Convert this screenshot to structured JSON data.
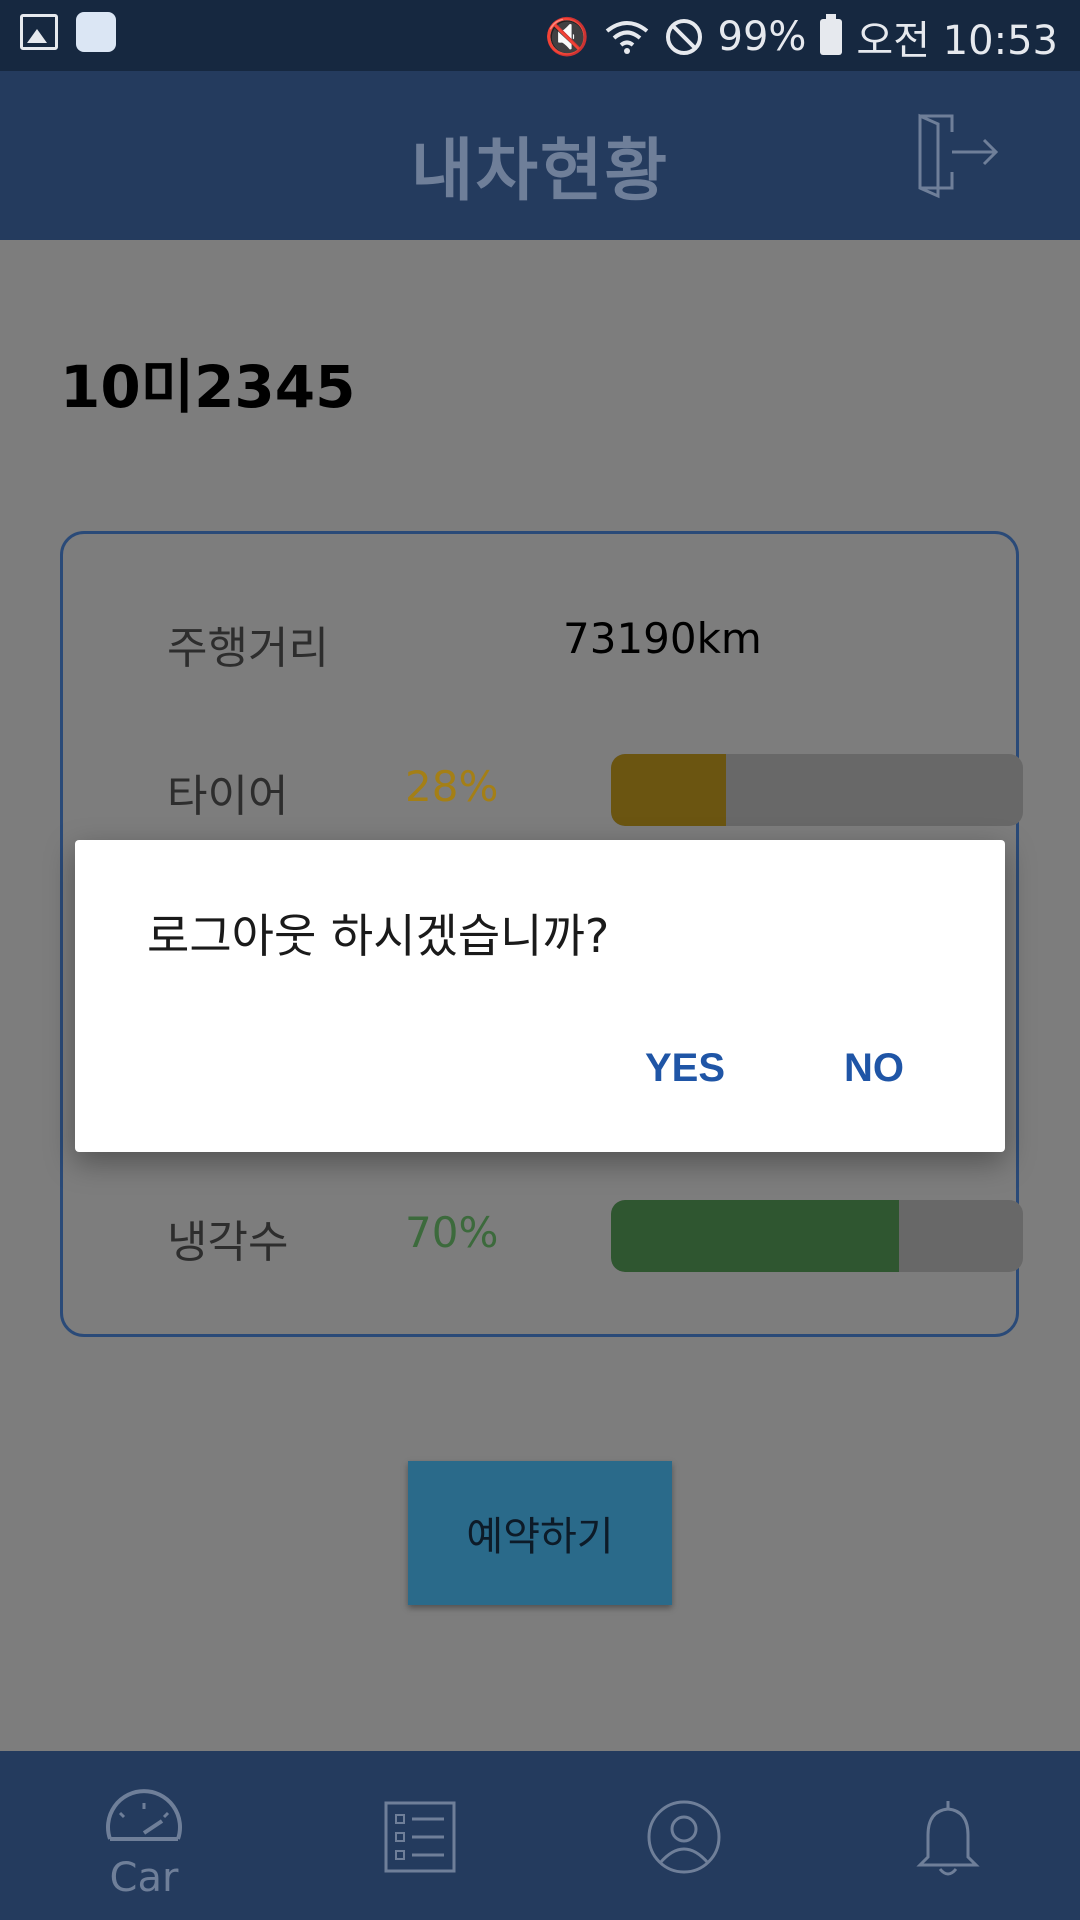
{
  "status_bar": {
    "battery_percent": "99%",
    "time": "오전 10:53"
  },
  "header": {
    "title": "내차현황",
    "logout_icon": "logout-icon"
  },
  "car": {
    "plate": "10미2345",
    "mileage_label": "주행거리",
    "mileage_value": "73190km",
    "tire_label": "타이어",
    "tire_percent": "28%",
    "tire_level": 0.28,
    "tire_color": "#6b5511",
    "coolant_label": "냉각수",
    "coolant_percent": "70%",
    "coolant_level": 0.7,
    "coolant_color": "#2f5630"
  },
  "actions": {
    "reserve_label": "예약하기"
  },
  "bottom_nav": {
    "car_label": "Car",
    "icons": [
      "speedometer-icon",
      "list-icon",
      "profile-icon",
      "bell-icon"
    ]
  },
  "dialog": {
    "message": "로그아웃 하시겠습니까?",
    "yes_label": "YES",
    "no_label": "NO"
  },
  "colors": {
    "primary": "#243b5e",
    "dialog_button": "#1f55a6",
    "tire_pct_text": "#a47f16",
    "coolant_pct_text": "#3c6a3c"
  }
}
